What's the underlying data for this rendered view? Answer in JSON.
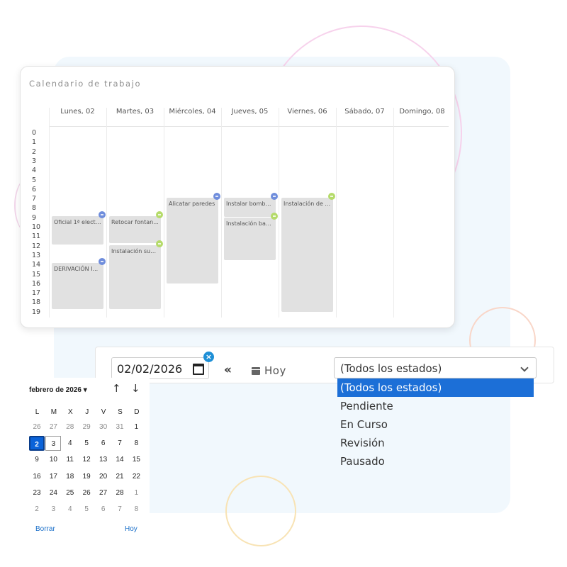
{
  "calendar": {
    "title": "Calendario de trabajo",
    "days": [
      "Lunes, 02",
      "Martes, 03",
      "Miércoles, 04",
      "Jueves, 05",
      "Viernes, 06",
      "Sábado, 07",
      "Domingo, 08"
    ],
    "hours": [
      "0",
      "1",
      "2",
      "3",
      "4",
      "5",
      "6",
      "7",
      "8",
      "9",
      "10",
      "11",
      "12",
      "13",
      "14",
      "15",
      "16",
      "17",
      "18",
      "19"
    ],
    "events": [
      {
        "label": "Oficial 1ª electri...",
        "day": 0,
        "start": 9.3,
        "end": 12.3,
        "status_color": "#6f8ddc"
      },
      {
        "label": "DERIVACIÓN I...",
        "day": 0,
        "start": 14.3,
        "end": 19.2,
        "status_color": "#6f8ddc"
      },
      {
        "label": "Retocar fontan...",
        "day": 1,
        "start": 9.3,
        "end": 12.2,
        "status_color": "#b5db6a"
      },
      {
        "label": "Instalación sue...",
        "day": 1,
        "start": 12.4,
        "end": 19.2,
        "status_color": "#b5db6a"
      },
      {
        "label": "Alicatar paredes",
        "day": 2,
        "start": 7.4,
        "end": 16.5,
        "status_color": "#6f8ddc"
      },
      {
        "label": "Instalar bomba...",
        "day": 3,
        "start": 7.4,
        "end": 9.4,
        "status_color": "#6f8ddc"
      },
      {
        "label": "Instalación bañ...",
        "day": 3,
        "start": 9.5,
        "end": 14.0,
        "status_color": "#b5db6a"
      },
      {
        "label": "Instalación de ...",
        "day": 4,
        "start": 7.4,
        "end": 19.5,
        "status_color": "#b5db6a"
      }
    ]
  },
  "filter": {
    "date_value": "02/02/2026",
    "prev_label": "«",
    "today_label": "Hoy",
    "status_selected": "(Todos los estados)",
    "status_options": [
      "(Todos los estados)",
      "Pendiente",
      "En Curso",
      "Revisión",
      "Pausado"
    ]
  },
  "date_picker": {
    "month_label": "febrero de 2026 ▾",
    "weekdays": [
      "L",
      "M",
      "X",
      "J",
      "V",
      "S",
      "D"
    ],
    "weeks": [
      [
        "26",
        "27",
        "28",
        "29",
        "30",
        "31",
        "1"
      ],
      [
        "2",
        "3",
        "4",
        "5",
        "6",
        "7",
        "8"
      ],
      [
        "9",
        "10",
        "11",
        "12",
        "13",
        "14",
        "15"
      ],
      [
        "16",
        "17",
        "18",
        "19",
        "20",
        "21",
        "22"
      ],
      [
        "23",
        "24",
        "25",
        "26",
        "27",
        "28",
        "1"
      ],
      [
        "2",
        "3",
        "4",
        "5",
        "6",
        "7",
        "8"
      ]
    ],
    "selected_day": "2",
    "today_day": "3",
    "clear_label": "Borrar",
    "today_label": "Hoy"
  },
  "colors": {
    "accent": "#1c6fd7",
    "status_blue": "#6f8ddc",
    "status_green": "#b5db6a"
  }
}
